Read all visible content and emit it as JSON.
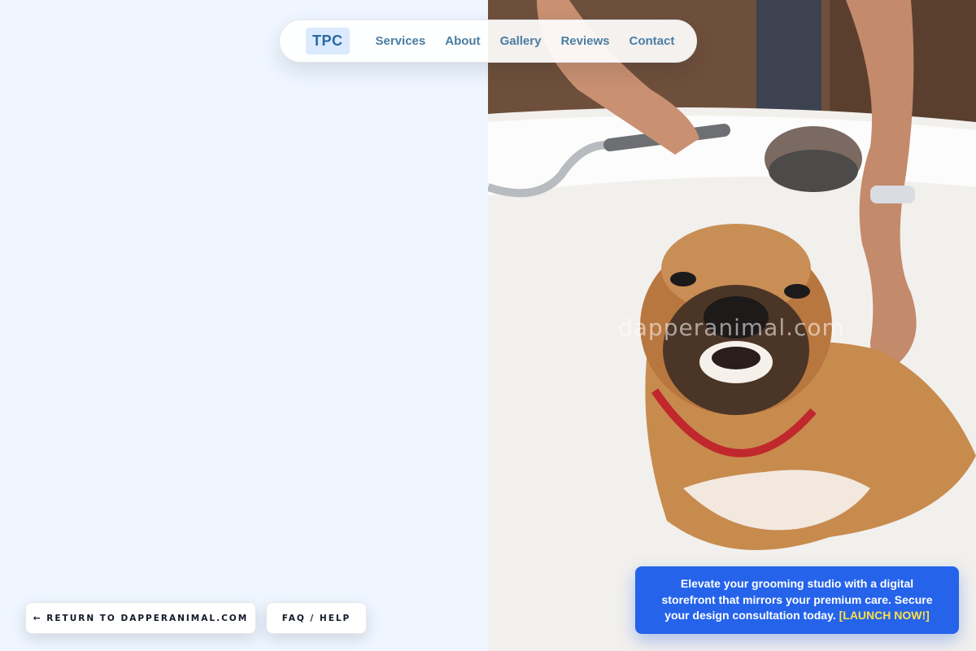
{
  "nav": {
    "logo": "TPC",
    "links": [
      "Services",
      "About",
      "Gallery",
      "Reviews",
      "Contact"
    ]
  },
  "photo": {
    "subject": "dog-bath-photo",
    "watermark": "dapperanimal.com"
  },
  "buttons": {
    "return_label": "← RETURN TO DAPPERANIMAL.COM",
    "faq_label": "FAQ / HELP"
  },
  "promo": {
    "text": "Elevate your grooming studio with a digital storefront that mirrors your premium care. Secure your design consultation today.",
    "cta": "[LAUNCH NOW!]"
  },
  "colors": {
    "background": "#eff6ff",
    "accent": "#2563eb",
    "nav_text": "#4a7da3",
    "cta_text": "#fde047"
  }
}
